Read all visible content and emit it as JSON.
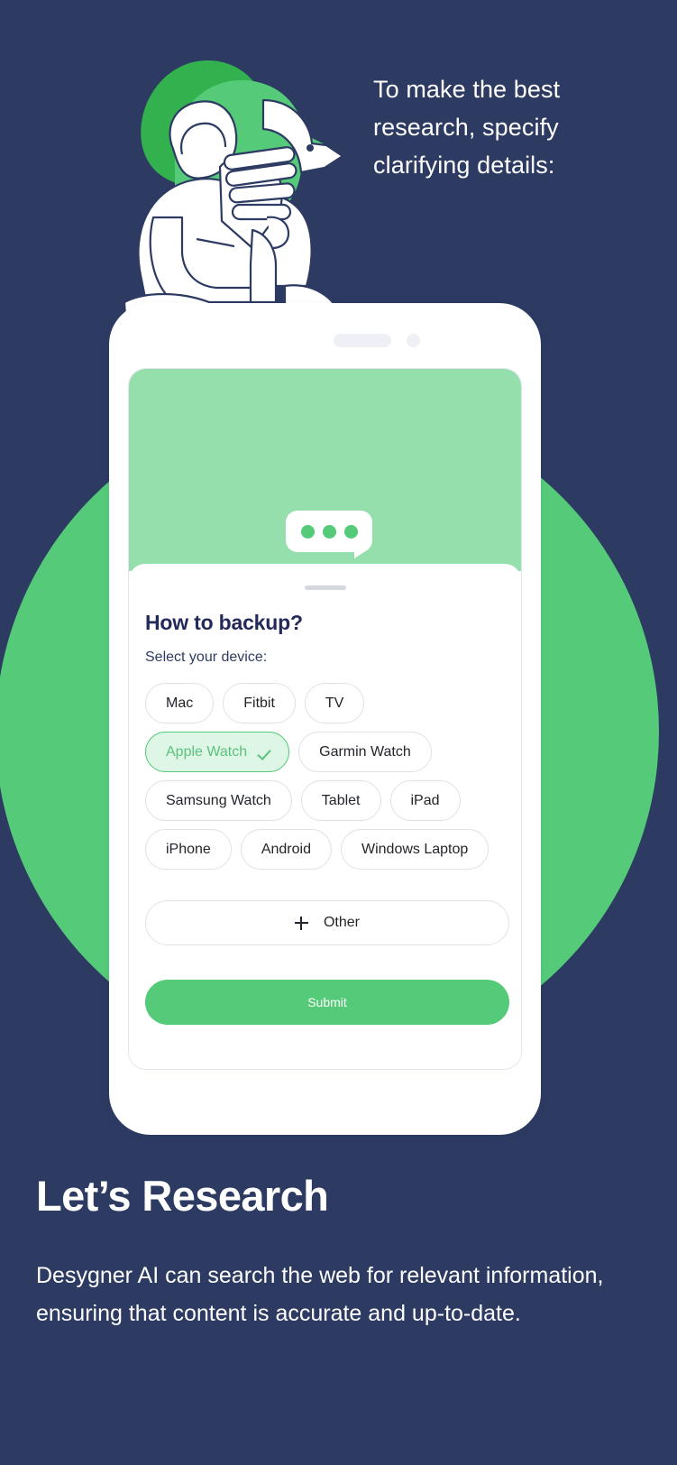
{
  "background": {
    "navy": "#2d3b63",
    "green": "#55cb79",
    "light_green": "#94dfab",
    "chip_selected_bg": "#ddf6e5"
  },
  "headline": "To make the best research, specify clarifying details:",
  "illustration": {
    "name": "thinking-person-illustration",
    "hair_color": "#33b14f",
    "hair_color_2": "#55cb79",
    "outline_color": "#2d3b63",
    "body_color": "#ffffff"
  },
  "phone": {
    "header_placeholder_bar": "",
    "header_placeholder_dot": "",
    "chat_bubble": {
      "name": "typing-indicator",
      "dots": 3
    },
    "sheet": {
      "title": "How to backup?",
      "subtitle": "Select your device:",
      "chips": [
        {
          "label": "Mac",
          "selected": false
        },
        {
          "label": "Fitbit",
          "selected": false
        },
        {
          "label": "TV",
          "selected": false
        },
        {
          "label": "Apple Watch",
          "selected": true
        },
        {
          "label": "Garmin Watch",
          "selected": false
        },
        {
          "label": "Samsung Watch",
          "selected": false
        },
        {
          "label": "Tablet",
          "selected": false
        },
        {
          "label": "iPad",
          "selected": false
        },
        {
          "label": "iPhone",
          "selected": false
        },
        {
          "label": "Android",
          "selected": false
        },
        {
          "label": "Windows Laptop",
          "selected": false
        }
      ],
      "other_label": "Other",
      "submit_label": "Submit"
    }
  },
  "footer": {
    "title": "Let’s Research",
    "body": "Desygner AI can search the web for relevant information, ensuring that content is accurate and up-to-date."
  }
}
